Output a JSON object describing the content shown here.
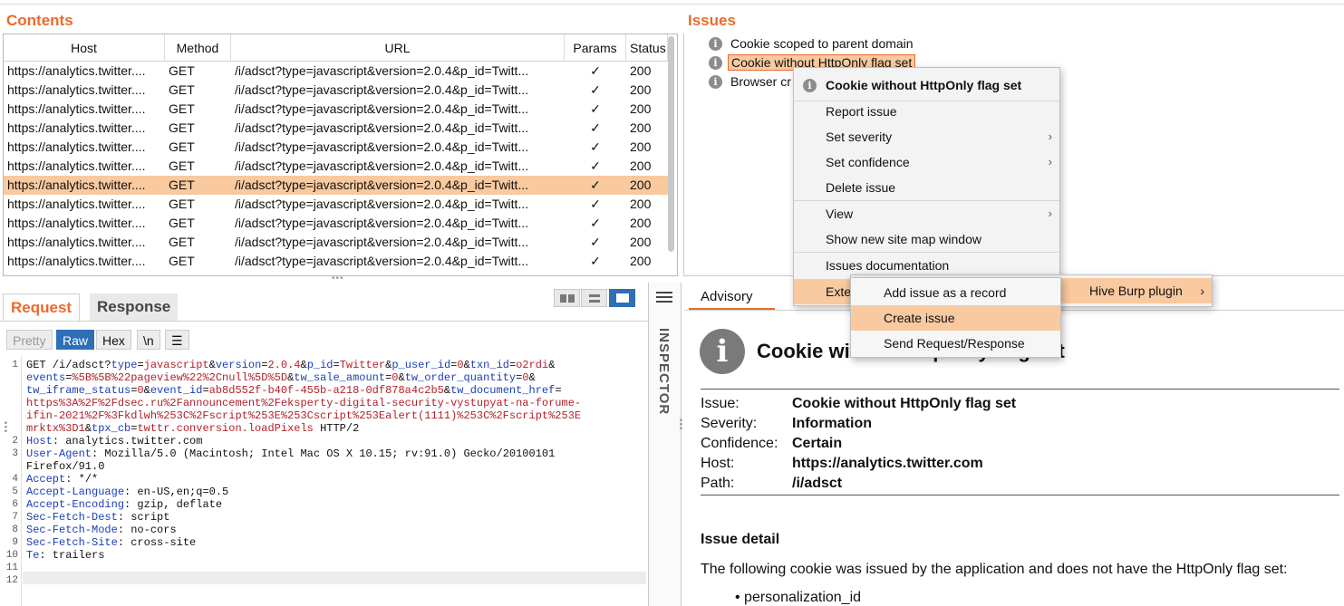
{
  "contents": {
    "title": "Contents",
    "columns": [
      "Host",
      "Method",
      "URL",
      "Params",
      "Status"
    ],
    "rows": [
      {
        "host": "https://analytics.twitter....",
        "method": "GET",
        "url": "/i/adsct?type=javascript&version=2.0.4&p_id=Twitt...",
        "params": "✓",
        "status": "200",
        "selected": false
      },
      {
        "host": "https://analytics.twitter....",
        "method": "GET",
        "url": "/i/adsct?type=javascript&version=2.0.4&p_id=Twitt...",
        "params": "✓",
        "status": "200",
        "selected": false
      },
      {
        "host": "https://analytics.twitter....",
        "method": "GET",
        "url": "/i/adsct?type=javascript&version=2.0.4&p_id=Twitt...",
        "params": "✓",
        "status": "200",
        "selected": false
      },
      {
        "host": "https://analytics.twitter....",
        "method": "GET",
        "url": "/i/adsct?type=javascript&version=2.0.4&p_id=Twitt...",
        "params": "✓",
        "status": "200",
        "selected": false
      },
      {
        "host": "https://analytics.twitter....",
        "method": "GET",
        "url": "/i/adsct?type=javascript&version=2.0.4&p_id=Twitt...",
        "params": "✓",
        "status": "200",
        "selected": false
      },
      {
        "host": "https://analytics.twitter....",
        "method": "GET",
        "url": "/i/adsct?type=javascript&version=2.0.4&p_id=Twitt...",
        "params": "✓",
        "status": "200",
        "selected": false
      },
      {
        "host": "https://analytics.twitter....",
        "method": "GET",
        "url": "/i/adsct?type=javascript&version=2.0.4&p_id=Twitt...",
        "params": "✓",
        "status": "200",
        "selected": true
      },
      {
        "host": "https://analytics.twitter....",
        "method": "GET",
        "url": "/i/adsct?type=javascript&version=2.0.4&p_id=Twitt...",
        "params": "✓",
        "status": "200",
        "selected": false
      },
      {
        "host": "https://analytics.twitter....",
        "method": "GET",
        "url": "/i/adsct?type=javascript&version=2.0.4&p_id=Twitt...",
        "params": "✓",
        "status": "200",
        "selected": false
      },
      {
        "host": "https://analytics.twitter....",
        "method": "GET",
        "url": "/i/adsct?type=javascript&version=2.0.4&p_id=Twitt...",
        "params": "✓",
        "status": "200",
        "selected": false
      },
      {
        "host": "https://analytics.twitter....",
        "method": "GET",
        "url": "/i/adsct?type=javascript&version=2.0.4&p_id=Twitt...",
        "params": "✓",
        "status": "200",
        "selected": false
      }
    ]
  },
  "issues": {
    "title": "Issues",
    "items": [
      {
        "label": "Cookie scoped to parent domain",
        "selected": false
      },
      {
        "label": "Cookie without HttpOnly flag set",
        "selected": true
      },
      {
        "label": "Browser cr",
        "selected": false
      }
    ]
  },
  "context_menu": {
    "header": "Cookie without HttpOnly flag set",
    "items": {
      "report": "Report issue",
      "severity": "Set severity",
      "confidence": "Set confidence",
      "delete": "Delete issue",
      "view": "View",
      "site_map": "Show new site map window",
      "docs": "Issues documentation",
      "extensions": "Exte"
    },
    "submenu_ext": {
      "hive": "Hive Burp plugin"
    },
    "submenu_hive": {
      "add_record": "Add issue as a record",
      "create_issue": "Create issue",
      "send_request": "Send Request/Response"
    },
    "arrow": "›"
  },
  "request": {
    "tabs": {
      "request": "Request",
      "response": "Response"
    },
    "format": {
      "pretty": "Pretty",
      "raw": "Raw",
      "hex": "Hex",
      "newline": "\\n",
      "menu": "☰"
    },
    "line_numbers": [
      "1",
      "",
      "",
      "",
      "",
      "",
      "2",
      "3",
      "",
      "4",
      "5",
      "6",
      "7",
      "8",
      "9",
      "10",
      "11",
      "12"
    ],
    "lines": [
      [
        {
          "t": "GET /i/adsct?",
          "c": ""
        },
        {
          "t": "type",
          "c": "k"
        },
        {
          "t": "=",
          "c": ""
        },
        {
          "t": "javascript",
          "c": "v"
        },
        {
          "t": "&",
          "c": ""
        },
        {
          "t": "version",
          "c": "k"
        },
        {
          "t": "=",
          "c": ""
        },
        {
          "t": "2.0.4",
          "c": "v"
        },
        {
          "t": "&",
          "c": ""
        },
        {
          "t": "p_id",
          "c": "k"
        },
        {
          "t": "=",
          "c": ""
        },
        {
          "t": "Twitter",
          "c": "v"
        },
        {
          "t": "&",
          "c": ""
        },
        {
          "t": "p_user_id",
          "c": "k"
        },
        {
          "t": "=",
          "c": ""
        },
        {
          "t": "0",
          "c": "v"
        },
        {
          "t": "&",
          "c": ""
        },
        {
          "t": "txn_id",
          "c": "k"
        },
        {
          "t": "=",
          "c": ""
        },
        {
          "t": "o2rdi",
          "c": "v"
        },
        {
          "t": "&",
          "c": ""
        }
      ],
      [
        {
          "t": "events",
          "c": "k"
        },
        {
          "t": "=",
          "c": ""
        },
        {
          "t": "%5B%5B%22pageview%22%2Cnull%5D%5D",
          "c": "v"
        },
        {
          "t": "&",
          "c": ""
        },
        {
          "t": "tw_sale_amount",
          "c": "k"
        },
        {
          "t": "=",
          "c": ""
        },
        {
          "t": "0",
          "c": "v"
        },
        {
          "t": "&",
          "c": ""
        },
        {
          "t": "tw_order_quantity",
          "c": "k"
        },
        {
          "t": "=",
          "c": ""
        },
        {
          "t": "0",
          "c": "v"
        },
        {
          "t": "&",
          "c": ""
        }
      ],
      [
        {
          "t": "tw_iframe_status",
          "c": "k"
        },
        {
          "t": "=",
          "c": ""
        },
        {
          "t": "0",
          "c": "v"
        },
        {
          "t": "&",
          "c": ""
        },
        {
          "t": "event_id",
          "c": "k"
        },
        {
          "t": "=",
          "c": ""
        },
        {
          "t": "ab8d552f-b40f-455b-a218-0df878a4c2b5",
          "c": "v"
        },
        {
          "t": "&",
          "c": ""
        },
        {
          "t": "tw_document_href",
          "c": "k"
        },
        {
          "t": "=",
          "c": ""
        }
      ],
      [
        {
          "t": "https%3A%2F%2Fdsec.ru%2Fannouncement%2Feksperty-digital-security-vystupyat-na-forume-",
          "c": "v"
        }
      ],
      [
        {
          "t": "ifin-2021%2F%3Fkdlwh%253C%2Fscript%253E%253Cscript%253Ealert(1111)%253C%2Fscript%253E",
          "c": "v"
        }
      ],
      [
        {
          "t": "mrktx%3D1",
          "c": "v"
        },
        {
          "t": "&",
          "c": ""
        },
        {
          "t": "tpx_cb",
          "c": "k"
        },
        {
          "t": "=",
          "c": ""
        },
        {
          "t": "twttr.conversion.loadPixels",
          "c": "v"
        },
        {
          "t": " HTTP/2",
          "c": ""
        }
      ],
      [
        {
          "t": "Host",
          "c": "k"
        },
        {
          "t": ": analytics.twitter.com",
          "c": ""
        }
      ],
      [
        {
          "t": "User-Agent",
          "c": "k"
        },
        {
          "t": ": Mozilla/5.0 (Macintosh; Intel Mac OS X 10.15; rv:91.0) Gecko/20100101",
          "c": ""
        }
      ],
      [
        {
          "t": "Firefox/91.0",
          "c": ""
        }
      ],
      [
        {
          "t": "Accept",
          "c": "k"
        },
        {
          "t": ": */*",
          "c": ""
        }
      ],
      [
        {
          "t": "Accept-Language",
          "c": "k"
        },
        {
          "t": ": en-US,en;q=0.5",
          "c": ""
        }
      ],
      [
        {
          "t": "Accept-Encoding",
          "c": "k"
        },
        {
          "t": ": gzip, deflate",
          "c": ""
        }
      ],
      [
        {
          "t": "Sec-Fetch-Dest",
          "c": "k"
        },
        {
          "t": ": script",
          "c": ""
        }
      ],
      [
        {
          "t": "Sec-Fetch-Mode",
          "c": "k"
        },
        {
          "t": ": no-cors",
          "c": ""
        }
      ],
      [
        {
          "t": "Sec-Fetch-Site",
          "c": "k"
        },
        {
          "t": ": cross-site",
          "c": ""
        }
      ],
      [
        {
          "t": "Te",
          "c": "k"
        },
        {
          "t": ": trailers",
          "c": ""
        }
      ],
      [],
      []
    ]
  },
  "inspector": {
    "label": "INSPECTOR"
  },
  "advisory": {
    "tab": "Advisory",
    "icon": "i",
    "title": "Cookie without HttpOnly flag set",
    "fields": [
      {
        "key": "Issue:",
        "value": "Cookie without HttpOnly flag set"
      },
      {
        "key": "Severity:",
        "value": "Information"
      },
      {
        "key": "Confidence:",
        "value": "Certain"
      },
      {
        "key": "Host:",
        "value": "https://analytics.twitter.com"
      },
      {
        "key": "Path:",
        "value": "/i/adsct"
      }
    ],
    "detail_heading": "Issue detail",
    "detail_text": "The following cookie was issued by the application and does not have the HttpOnly flag set:",
    "detail_item": "• personalization_id"
  },
  "colors": {
    "accent": "#ec6a2c",
    "selection": "#f9c99f",
    "active_button": "#2e6fb5"
  }
}
